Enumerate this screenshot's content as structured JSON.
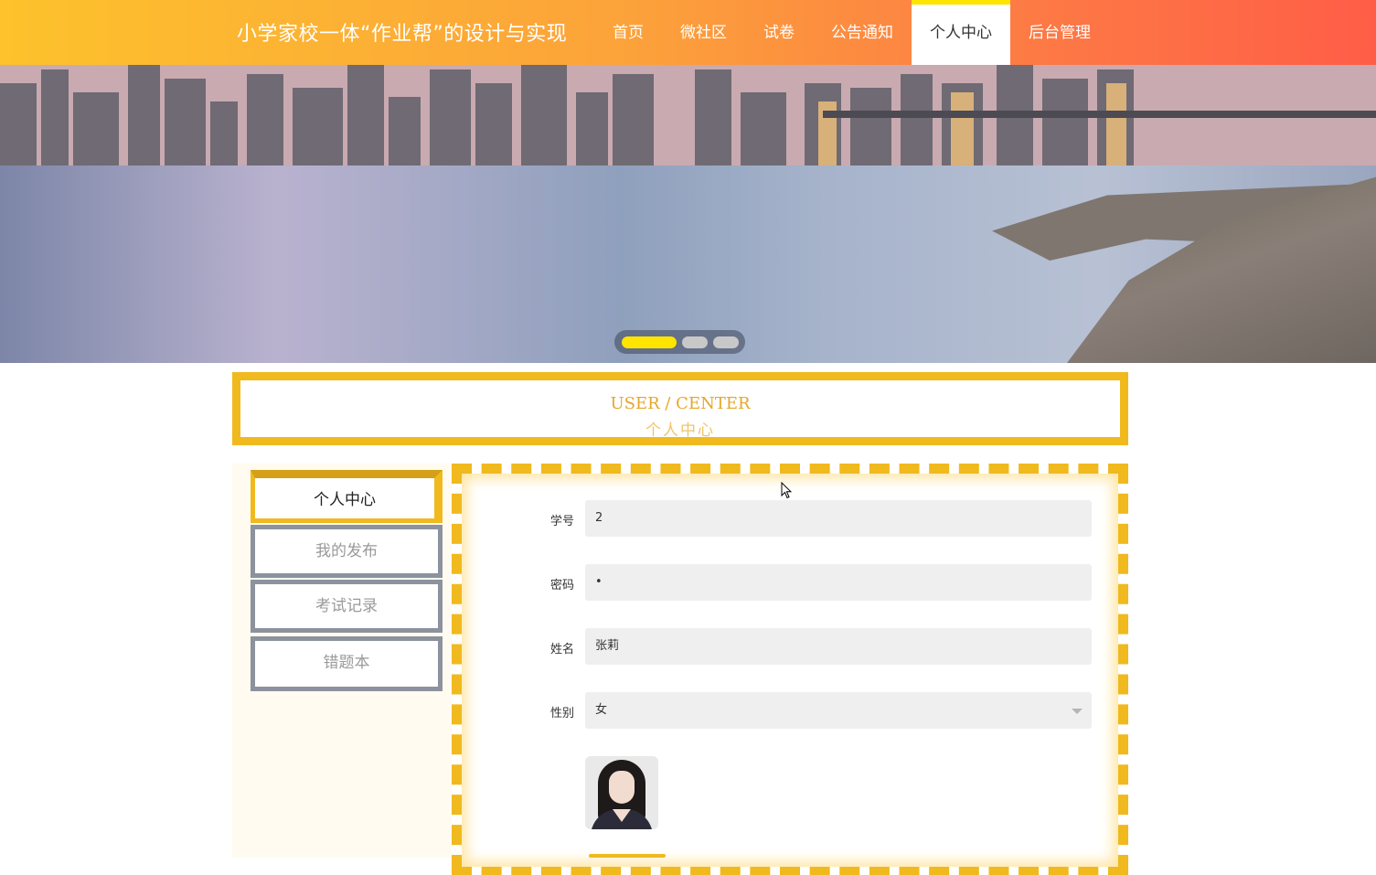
{
  "header": {
    "site_title": "小学家校一体“作业帮”的设计与实现",
    "nav": [
      {
        "label": "首页",
        "active": false
      },
      {
        "label": "微社区",
        "active": false
      },
      {
        "label": "试卷",
        "active": false
      },
      {
        "label": "公告通知",
        "active": false
      },
      {
        "label": "个人中心",
        "active": true
      },
      {
        "label": "后台管理",
        "active": false
      }
    ]
  },
  "banner": {
    "slide_count": 3,
    "active_slide": 1
  },
  "section": {
    "title_en": "USER / CENTER",
    "title_zh": "个人中心"
  },
  "sidebar": {
    "items": [
      {
        "label": "个人中心",
        "active": true
      },
      {
        "label": "我的发布",
        "active": false
      },
      {
        "label": "考试记录",
        "active": false
      },
      {
        "label": "错题本",
        "active": false
      }
    ]
  },
  "form": {
    "student_id": {
      "label": "学号",
      "value": "2"
    },
    "password": {
      "label": "密码",
      "value": "•"
    },
    "name": {
      "label": "姓名",
      "value": "张莉"
    },
    "gender": {
      "label": "性别",
      "value": "女"
    }
  },
  "colors": {
    "accent": "#f0b91e",
    "header_start": "#fdc22c",
    "header_end": "#ff5d47",
    "active_indicator": "#ffe400"
  }
}
